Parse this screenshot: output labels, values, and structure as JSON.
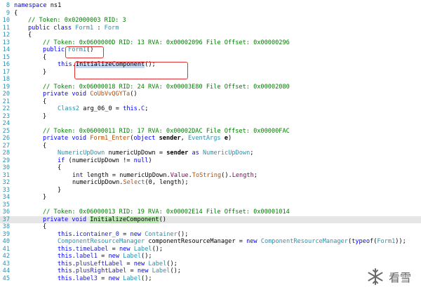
{
  "editor": {
    "lines": [
      {
        "n": "8",
        "indent": 0,
        "tokens": [
          [
            "kw",
            "namespace "
          ],
          [
            "id",
            "ns1"
          ]
        ]
      },
      {
        "n": "9",
        "indent": 0,
        "tokens": [
          [
            "id",
            "{"
          ]
        ]
      },
      {
        "n": "10",
        "indent": 1,
        "tokens": [
          [
            "cm",
            "// Token: 0x02000003 RID: 3"
          ]
        ]
      },
      {
        "n": "11",
        "indent": 1,
        "tokens": [
          [
            "kw",
            "public class "
          ],
          [
            "type",
            "Form1"
          ],
          [
            "id",
            " : "
          ],
          [
            "type",
            "Form"
          ]
        ]
      },
      {
        "n": "12",
        "indent": 1,
        "tokens": [
          [
            "id",
            "{"
          ]
        ]
      },
      {
        "n": "13",
        "indent": 2,
        "tokens": [
          [
            "cm",
            "// Token: 0x0600000D RID: 13 RVA: 0x00002096 File Offset: 0x00000296"
          ]
        ]
      },
      {
        "n": "14",
        "indent": 2,
        "tokens": [
          [
            "kw",
            "public "
          ],
          [
            "type",
            "Form1"
          ],
          [
            "id",
            "()"
          ]
        ]
      },
      {
        "n": "15",
        "indent": 2,
        "tokens": [
          [
            "id",
            "{"
          ]
        ]
      },
      {
        "n": "16",
        "indent": 3,
        "tokens": [
          [
            "kw",
            "this"
          ],
          [
            "id",
            "."
          ],
          [
            "sel",
            "InitializeComponent"
          ],
          [
            "id",
            "();"
          ]
        ]
      },
      {
        "n": "17",
        "indent": 2,
        "tokens": [
          [
            "id",
            "}"
          ]
        ]
      },
      {
        "n": "18",
        "indent": 0,
        "tokens": []
      },
      {
        "n": "19",
        "indent": 2,
        "tokens": [
          [
            "cm",
            "// Token: 0x06000018 RID: 24 RVA: 0x00003E80 File Offset: 0x00002080"
          ]
        ]
      },
      {
        "n": "20",
        "indent": 2,
        "tokens": [
          [
            "kw",
            "private void "
          ],
          [
            "m",
            "CoUbVvQGYTa"
          ],
          [
            "id",
            "()"
          ]
        ]
      },
      {
        "n": "21",
        "indent": 2,
        "tokens": [
          [
            "id",
            "{"
          ]
        ]
      },
      {
        "n": "22",
        "indent": 3,
        "tokens": [
          [
            "type",
            "Class2"
          ],
          [
            "id",
            " arg_06_0 = "
          ],
          [
            "kw",
            "this"
          ],
          [
            "id",
            "."
          ],
          [
            "fld",
            "C"
          ],
          [
            "id",
            ";"
          ]
        ]
      },
      {
        "n": "23",
        "indent": 2,
        "tokens": [
          [
            "id",
            "}"
          ]
        ]
      },
      {
        "n": "24",
        "indent": 0,
        "tokens": []
      },
      {
        "n": "25",
        "indent": 2,
        "tokens": [
          [
            "cm",
            "// Token: 0x06000011 RID: 17 RVA: 0x00002DAC File Offset: 0x00000FAC"
          ]
        ]
      },
      {
        "n": "26",
        "indent": 2,
        "tokens": [
          [
            "kw",
            "private void "
          ],
          [
            "m",
            "Form1_Enter"
          ],
          [
            "id",
            "("
          ],
          [
            "kw",
            "object "
          ],
          [
            "pm",
            "sender"
          ],
          [
            "id",
            ", "
          ],
          [
            "type",
            "EventArgs "
          ],
          [
            "pm",
            "e"
          ],
          [
            "id",
            ")"
          ]
        ]
      },
      {
        "n": "27",
        "indent": 2,
        "tokens": [
          [
            "id",
            "{"
          ]
        ]
      },
      {
        "n": "28",
        "indent": 3,
        "tokens": [
          [
            "type",
            "NumericUpDown"
          ],
          [
            "id",
            " numericUpDown = "
          ],
          [
            "pm",
            "sender"
          ],
          [
            "kw",
            " as "
          ],
          [
            "type",
            "NumericUpDown"
          ],
          [
            "id",
            ";"
          ]
        ]
      },
      {
        "n": "29",
        "indent": 3,
        "tokens": [
          [
            "kw",
            "if "
          ],
          [
            "id",
            "(numericUpDown != "
          ],
          [
            "kw",
            "null"
          ],
          [
            "id",
            ")"
          ]
        ]
      },
      {
        "n": "30",
        "indent": 3,
        "tokens": [
          [
            "id",
            "{"
          ]
        ]
      },
      {
        "n": "31",
        "indent": 4,
        "tokens": [
          [
            "kw",
            "int "
          ],
          [
            "id",
            "length = numericUpDown."
          ],
          [
            "prop",
            "Value"
          ],
          [
            "id",
            "."
          ],
          [
            "m",
            "ToString"
          ],
          [
            "id",
            "()."
          ],
          [
            "prop",
            "Length"
          ],
          [
            "id",
            ";"
          ]
        ]
      },
      {
        "n": "32",
        "indent": 4,
        "tokens": [
          [
            "id",
            "numericUpDown."
          ],
          [
            "m",
            "Select"
          ],
          [
            "id",
            "(0, length);"
          ]
        ]
      },
      {
        "n": "33",
        "indent": 3,
        "tokens": [
          [
            "id",
            "}"
          ]
        ]
      },
      {
        "n": "34",
        "indent": 2,
        "tokens": [
          [
            "id",
            "}"
          ]
        ]
      },
      {
        "n": "35",
        "indent": 0,
        "tokens": []
      },
      {
        "n": "36",
        "indent": 2,
        "tokens": [
          [
            "cm",
            "// Token: 0x06000013 RID: 19 RVA: 0x00002E14 File Offset: 0x00001014"
          ]
        ]
      },
      {
        "n": "37",
        "indent": 2,
        "current": true,
        "tokens": [
          [
            "kw",
            "private void "
          ],
          [
            "hl",
            "InitializeComponent"
          ],
          [
            "id",
            "()"
          ]
        ]
      },
      {
        "n": "38",
        "indent": 2,
        "tokens": [
          [
            "id",
            "{"
          ]
        ]
      },
      {
        "n": "39",
        "indent": 3,
        "tokens": [
          [
            "kw",
            "this"
          ],
          [
            "id",
            "."
          ],
          [
            "fld",
            "icontainer_0"
          ],
          [
            "id",
            " = "
          ],
          [
            "kw",
            "new "
          ],
          [
            "type",
            "Container"
          ],
          [
            "id",
            "();"
          ]
        ]
      },
      {
        "n": "40",
        "indent": 3,
        "tokens": [
          [
            "type",
            "ComponentResourceManager"
          ],
          [
            "id",
            " componentResourceManager = "
          ],
          [
            "kw",
            "new "
          ],
          [
            "type",
            "ComponentResourceManager"
          ],
          [
            "id",
            "("
          ],
          [
            "kw",
            "typeof"
          ],
          [
            "id",
            "("
          ],
          [
            "type",
            "Form1"
          ],
          [
            "id",
            "));"
          ]
        ]
      },
      {
        "n": "41",
        "indent": 3,
        "tokens": [
          [
            "kw",
            "this"
          ],
          [
            "id",
            "."
          ],
          [
            "fld",
            "timeLabel"
          ],
          [
            "id",
            " = "
          ],
          [
            "kw",
            "new "
          ],
          [
            "type",
            "Label"
          ],
          [
            "id",
            "();"
          ]
        ]
      },
      {
        "n": "42",
        "indent": 3,
        "tokens": [
          [
            "kw",
            "this"
          ],
          [
            "id",
            "."
          ],
          [
            "fld",
            "label1"
          ],
          [
            "id",
            " = "
          ],
          [
            "kw",
            "new "
          ],
          [
            "type",
            "Label"
          ],
          [
            "id",
            "();"
          ]
        ]
      },
      {
        "n": "43",
        "indent": 3,
        "tokens": [
          [
            "kw",
            "this"
          ],
          [
            "id",
            "."
          ],
          [
            "fld",
            "plusLeftLabel"
          ],
          [
            "id",
            " = "
          ],
          [
            "kw",
            "new "
          ],
          [
            "type",
            "Label"
          ],
          [
            "id",
            "();"
          ]
        ]
      },
      {
        "n": "44",
        "indent": 3,
        "tokens": [
          [
            "kw",
            "this"
          ],
          [
            "id",
            "."
          ],
          [
            "fld",
            "plusRightLabel"
          ],
          [
            "id",
            " = "
          ],
          [
            "kw",
            "new "
          ],
          [
            "type",
            "Label"
          ],
          [
            "id",
            "();"
          ]
        ]
      },
      {
        "n": "45",
        "indent": 3,
        "tokens": [
          [
            "kw",
            "this"
          ],
          [
            "id",
            "."
          ],
          [
            "fld",
            "label3"
          ],
          [
            "id",
            " = "
          ],
          [
            "kw",
            "new "
          ],
          [
            "type",
            "Label"
          ],
          [
            "id",
            "();"
          ]
        ]
      }
    ]
  },
  "watermark": {
    "text": "看雪",
    "icon": "snowflake-icon"
  }
}
